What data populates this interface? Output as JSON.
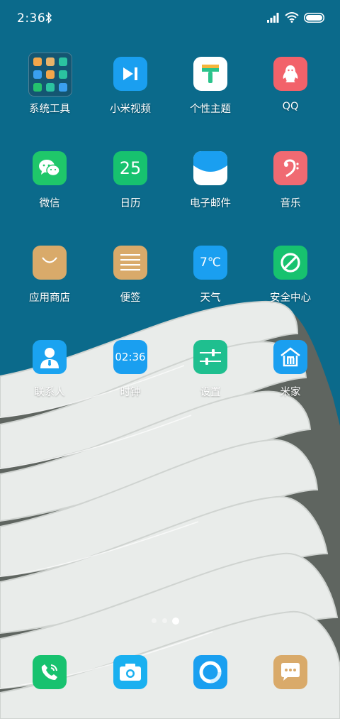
{
  "status_bar": {
    "time": "2:36"
  },
  "apps": [
    {
      "label": "系统工具",
      "icon": "folder-icon"
    },
    {
      "label": "小米视频",
      "icon": "play-icon",
      "color": "#1a9ff0"
    },
    {
      "label": "个性主题",
      "icon": "brush-icon",
      "color": "#ffffff"
    },
    {
      "label": "QQ",
      "icon": "penguin-icon",
      "color": "#f2626a"
    },
    {
      "label": "微信",
      "icon": "chat-bubbles-icon",
      "color": "#1fc76a"
    },
    {
      "label": "日历",
      "icon": "calendar-icon",
      "color": "#17c26f",
      "icon_text": "25"
    },
    {
      "label": "电子邮件",
      "icon": "envelope-icon",
      "color": "#ffffff"
    },
    {
      "label": "音乐",
      "icon": "bass-clef-icon",
      "color": "#f06a72"
    },
    {
      "label": "应用商店",
      "icon": "shopping-bag-icon",
      "color": "#d9aa6a"
    },
    {
      "label": "便签",
      "icon": "lined-note-icon",
      "color": "#d9aa6a"
    },
    {
      "label": "天气",
      "icon": "weather-icon",
      "color": "#1a9ff0",
      "icon_text": "7℃"
    },
    {
      "label": "安全中心",
      "icon": "prohibition-icon",
      "color": "#17c26f"
    },
    {
      "label": "联系人",
      "icon": "person-icon",
      "color": "#1aa3f0"
    },
    {
      "label": "时钟",
      "icon": "clock-icon",
      "color": "#1a9ff0",
      "icon_text": "02:36"
    },
    {
      "label": "设置",
      "icon": "sliders-icon",
      "color": "#1fbf8f"
    },
    {
      "label": "米家",
      "icon": "home-icon",
      "color": "#1a9ff0"
    }
  ],
  "dock": [
    {
      "icon": "phone-icon",
      "color": "#17c26f"
    },
    {
      "icon": "camera-icon",
      "color": "#1ab0f0"
    },
    {
      "icon": "browser-ring-icon",
      "color": "#1a9ff0"
    },
    {
      "icon": "message-icon",
      "color": "#d9aa6a"
    }
  ],
  "pager": {
    "pages": 3,
    "current": 3
  }
}
